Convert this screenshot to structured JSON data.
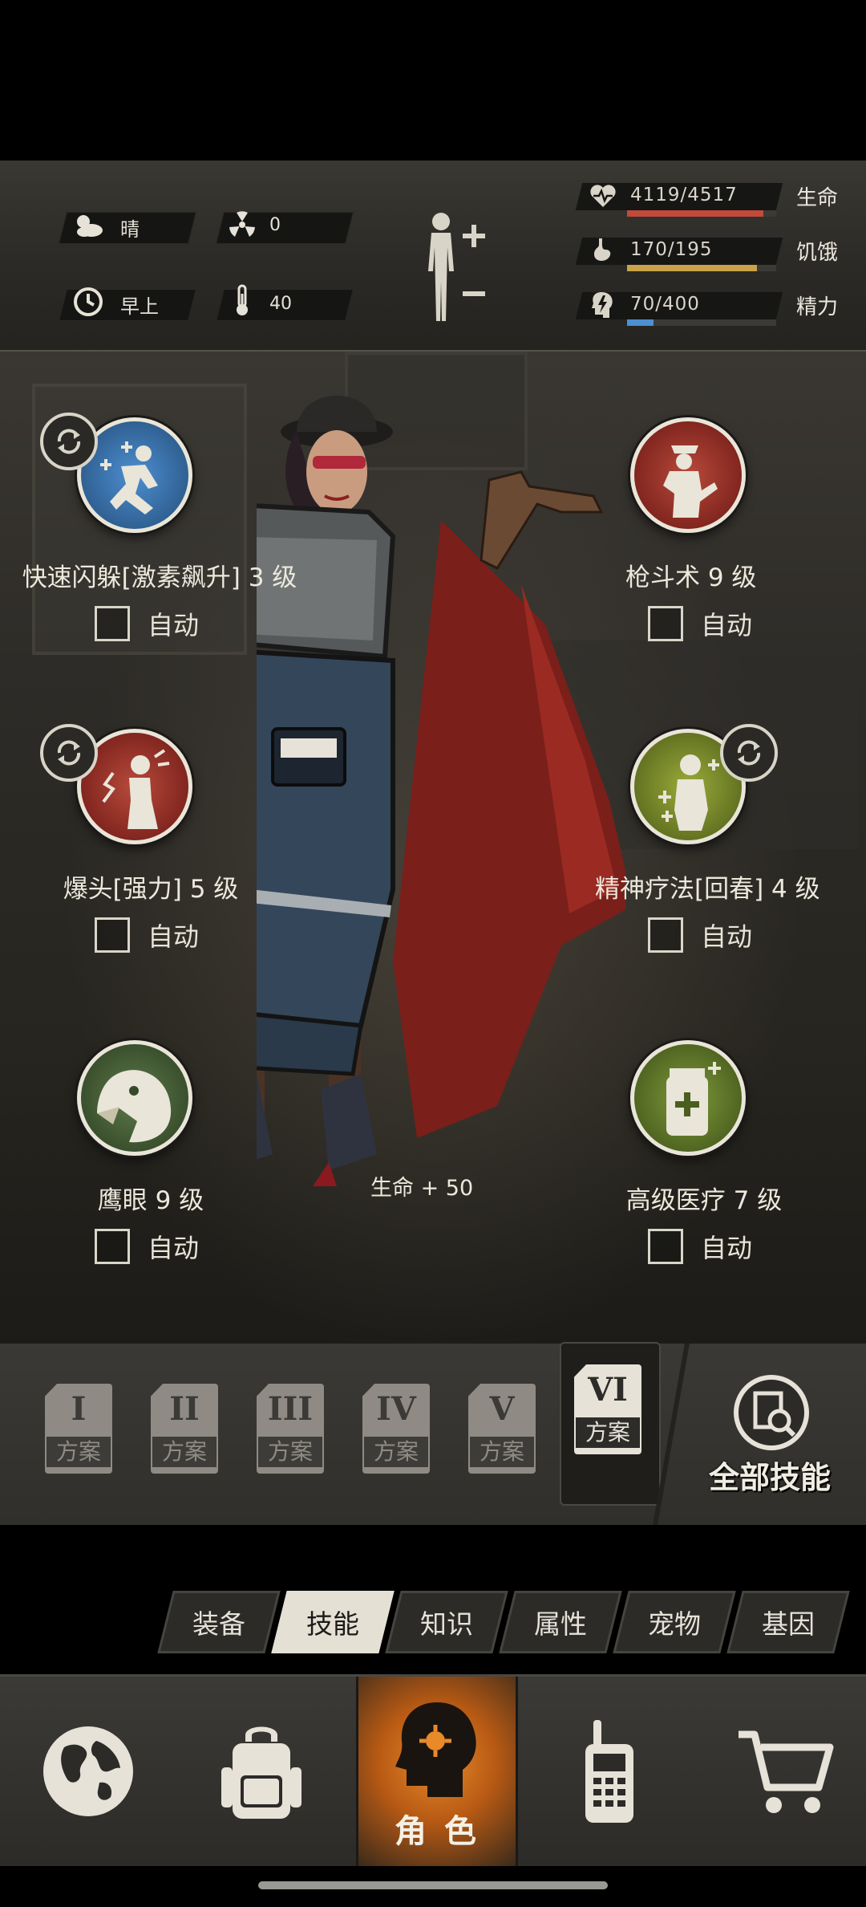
{
  "status": {
    "weather": "晴",
    "radiation": "0",
    "time_of_day": "早上",
    "temperature": "40"
  },
  "stats": [
    {
      "icon": "heart-pulse-icon",
      "value": "4119/4517",
      "label": "生命",
      "fraction": 0.912,
      "color": "#c24a3a"
    },
    {
      "icon": "stomach-icon",
      "value": "170/195",
      "label": "饥饿",
      "fraction": 0.872,
      "color": "#c9a24a"
    },
    {
      "icon": "brain-bolt-icon",
      "value": "70/400",
      "label": "精力",
      "fraction": 0.175,
      "color": "#4d8fd1"
    }
  ],
  "skills": [
    {
      "name": "快速闪躲[激素飙升] 3 级",
      "auto_label": "自动",
      "icon": "dodge-icon",
      "cycle": true
    },
    {
      "name": "枪斗术 9 级",
      "auto_label": "自动",
      "icon": "gunfight-icon",
      "cycle": false
    },
    {
      "name": "爆头[强力] 5 级",
      "auto_label": "自动",
      "icon": "headshot-icon",
      "cycle": true
    },
    {
      "name": "精神疗法[回春] 4 级",
      "auto_label": "自动",
      "icon": "psychotherapy-icon",
      "cycle": true
    },
    {
      "name": "鹰眼 9 级",
      "auto_label": "自动",
      "icon": "eagle-eye-icon",
      "cycle": false
    },
    {
      "name": "高级医疗 7 级",
      "auto_label": "自动",
      "icon": "advanced-medical-icon",
      "cycle": false
    }
  ],
  "character_bonus": "生命 + 50",
  "plans": [
    {
      "roman": "I",
      "word": "方案"
    },
    {
      "roman": "II",
      "word": "方案"
    },
    {
      "roman": "III",
      "word": "方案"
    },
    {
      "roman": "IV",
      "word": "方案"
    },
    {
      "roman": "V",
      "word": "方案"
    },
    {
      "roman": "VI",
      "word": "方案",
      "active": true
    }
  ],
  "all_skills_label": "全部技能",
  "tabs": [
    "装备",
    "技能",
    "知识",
    "属性",
    "宠物",
    "基因"
  ],
  "active_tab": "技能",
  "nav": {
    "items": [
      "globe-icon",
      "backpack-icon",
      "character-icon",
      "radio-icon",
      "cart-icon"
    ],
    "active_label": "角 色"
  }
}
